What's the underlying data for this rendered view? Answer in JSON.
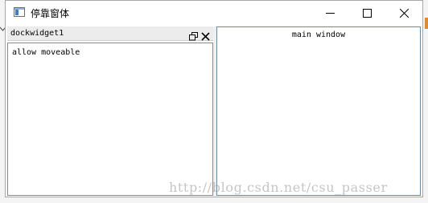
{
  "window": {
    "title": "停靠窗体",
    "controls": {
      "minimize": "minimize-icon",
      "maximize": "maximize-icon",
      "close": "close-icon"
    }
  },
  "dock_widget": {
    "title": "dockwidget1",
    "content_text": "allow moveable",
    "buttons": {
      "float": "float-icon",
      "close": "close-icon"
    }
  },
  "central_widget": {
    "text": "main window"
  },
  "watermark": {
    "text": "http://blog.csdn.net/csu_passer"
  },
  "colors": {
    "central_border": "#4f8fc4",
    "dock_titlebar_bg": "#ececec",
    "backdrop_accent": "#e08a2c"
  }
}
